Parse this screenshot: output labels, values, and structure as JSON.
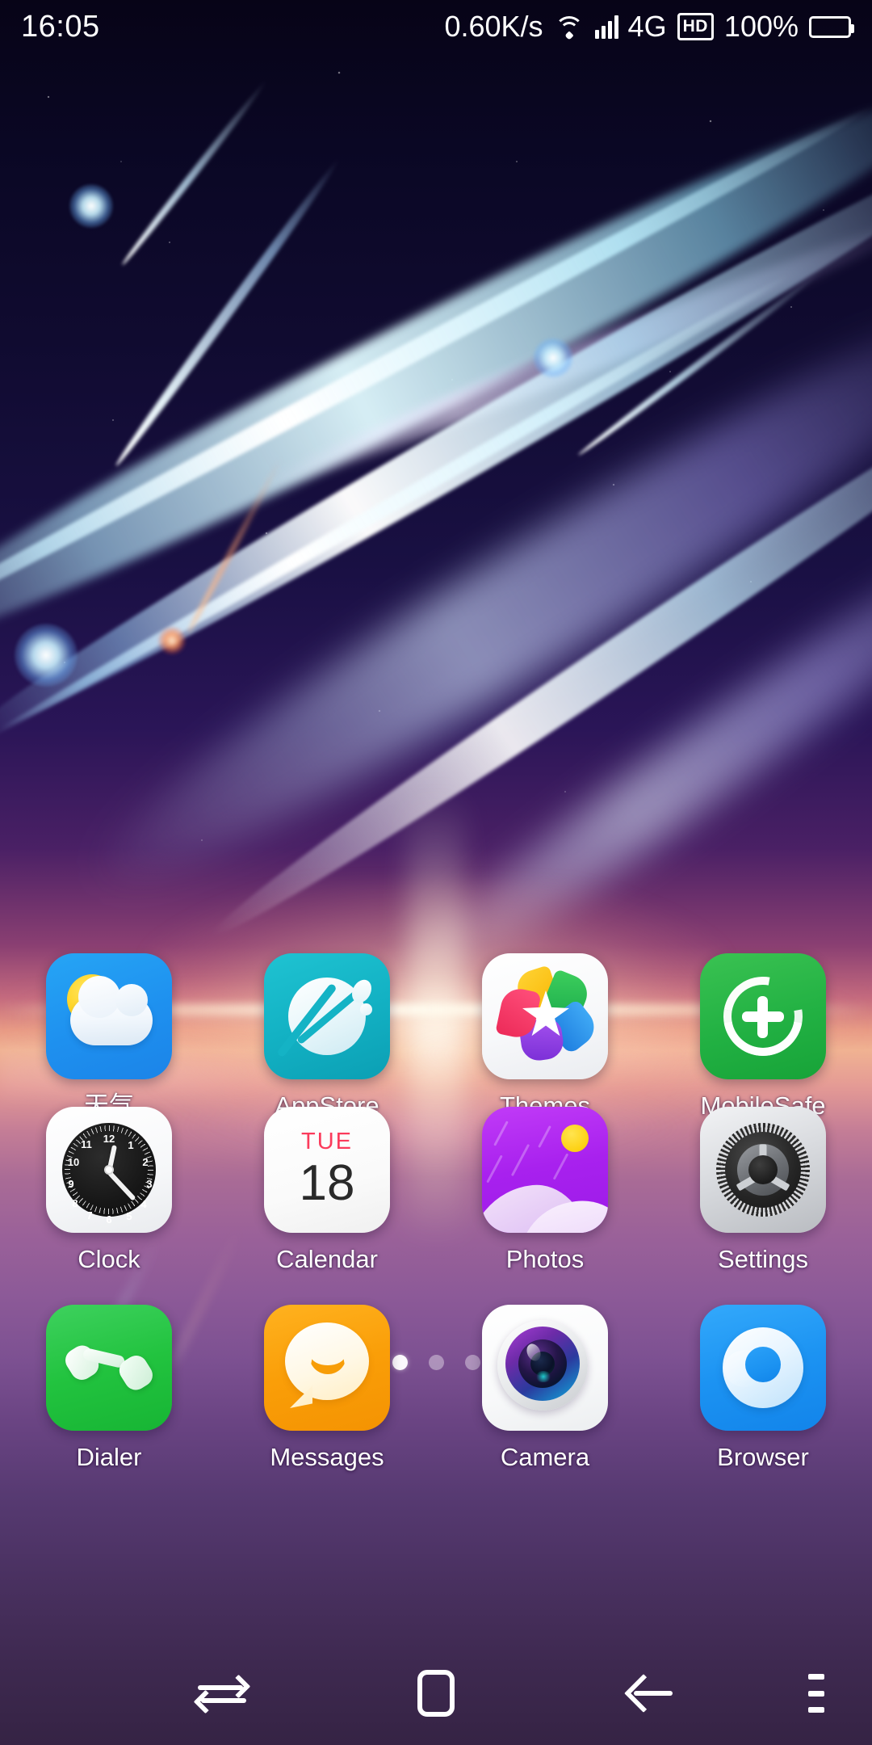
{
  "status_bar": {
    "clock": "16:05",
    "network_speed": "0.60K/s",
    "wifi_icon": "wifi-icon",
    "signal_icon": "cellular-signal-icon",
    "network_type": "4G",
    "hd_badge": "HD",
    "battery_percent": "100%",
    "battery_icon": "battery-full-icon"
  },
  "home_screen": {
    "rows": [
      {
        "id": "row-1",
        "apps": [
          {
            "label": "天气",
            "icon": "weather-icon"
          },
          {
            "label": "AppStore",
            "icon": "appstore-icon"
          },
          {
            "label": "Themes",
            "icon": "themes-icon"
          },
          {
            "label": "MobileSafe",
            "icon": "mobilesafe-icon"
          }
        ]
      },
      {
        "id": "row-2",
        "apps": [
          {
            "label": "Clock",
            "icon": "clock-icon"
          },
          {
            "label": "Calendar",
            "icon": "calendar-icon"
          },
          {
            "label": "Photos",
            "icon": "photos-icon"
          },
          {
            "label": "Settings",
            "icon": "settings-icon"
          }
        ]
      }
    ],
    "dock": {
      "apps": [
        {
          "label": "Dialer",
          "icon": "phone-icon"
        },
        {
          "label": "Messages",
          "icon": "message-bubble-icon"
        },
        {
          "label": "Camera",
          "icon": "camera-icon"
        },
        {
          "label": "Browser",
          "icon": "browser-icon"
        }
      ]
    },
    "calendar_widget": {
      "day_of_week": "TUE",
      "day_number": "18"
    },
    "page_indicator": {
      "total_pages": 3,
      "active_page": 1
    }
  },
  "nav_bar": {
    "recents_label": "recents-icon",
    "home_label": "home-icon",
    "back_label": "back-icon",
    "menu_label": "menu-icon"
  },
  "colors": {
    "weather_blue": "#1e90ef",
    "appstore_teal": "#13b2c4",
    "mobilesafe_green": "#22b143",
    "photos_purple": "#a821ee",
    "dialer_green": "#22c33f",
    "messages_orange": "#fa9e08",
    "browser_blue": "#1c93f2",
    "calendar_red": "#fb3b5c",
    "status_text": "#ffffff"
  }
}
